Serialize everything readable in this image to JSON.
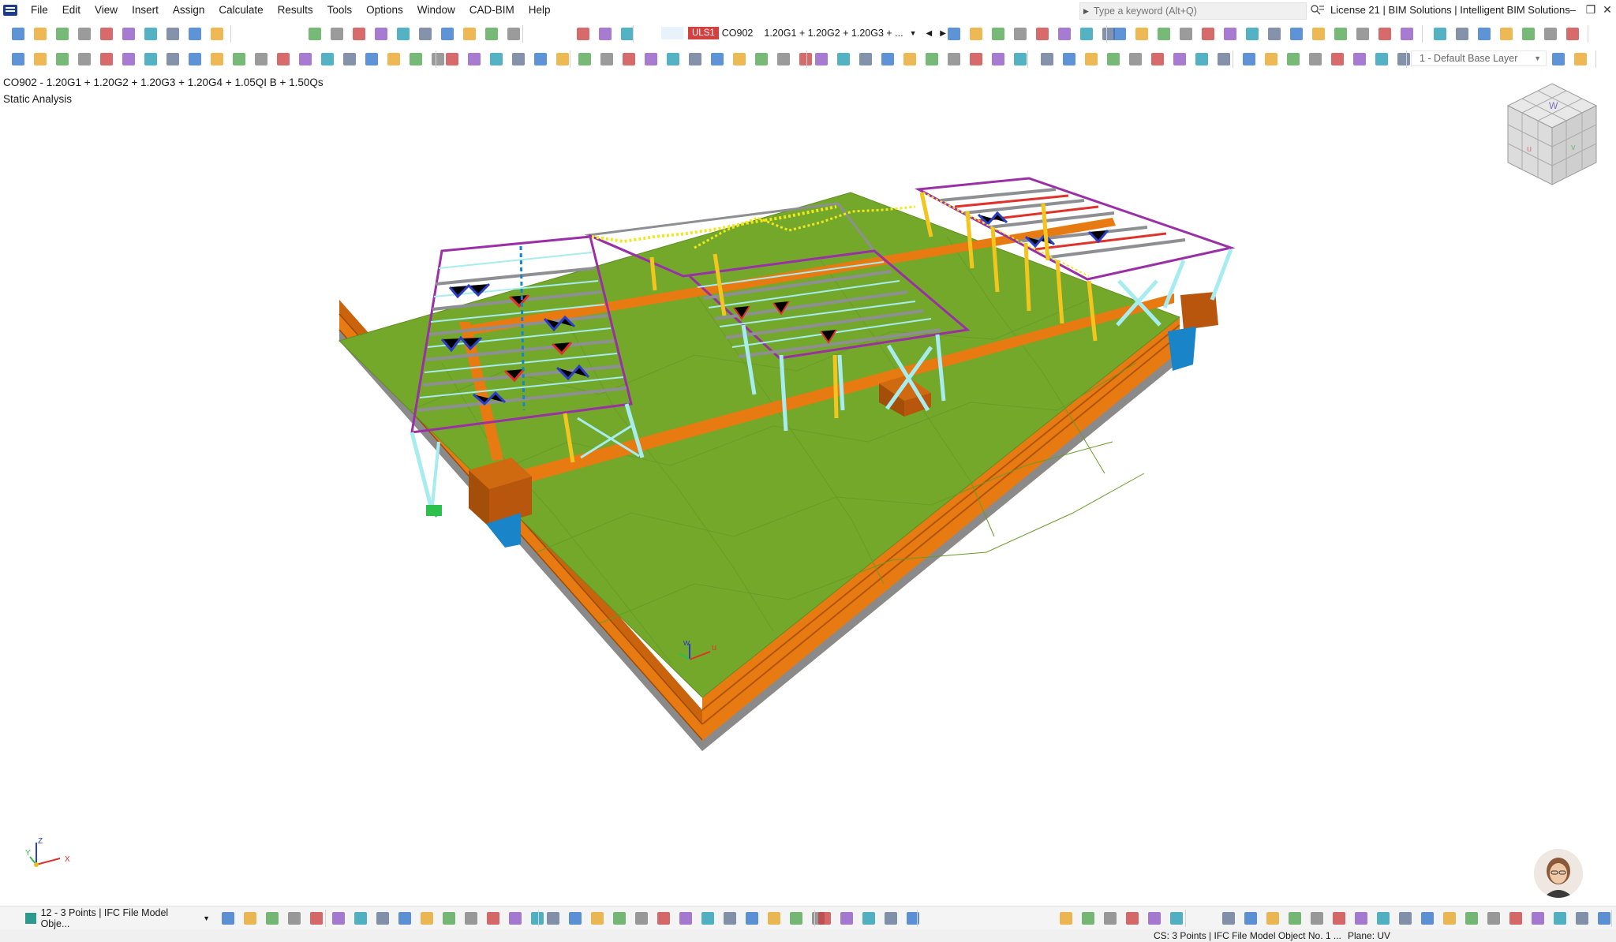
{
  "menu": {
    "items": [
      "File",
      "Edit",
      "View",
      "Insert",
      "Assign",
      "Calculate",
      "Results",
      "Tools",
      "Options",
      "Window",
      "CAD-BIM",
      "Help"
    ]
  },
  "search": {
    "placeholder": "Type a keyword (Alt+Q)"
  },
  "license": {
    "text": "License 21 | BIM Solutions | Intelligent BIM Solutions"
  },
  "window_controls": {
    "minimize": "–",
    "restore": "❐",
    "close": "✕"
  },
  "load_combo": {
    "badge": "ULS1",
    "id": "CO902",
    "formula": "1.20G1 + 1.20G2 + 1.20G3 + ...",
    "prev": "◀",
    "next": "▶"
  },
  "layer": {
    "value": "1 - Default Base Layer"
  },
  "viewport": {
    "combination_line": "CO902 - 1.20G1 + 1.20G2 + 1.20G3 + 1.20G4 + 1.05QI B + 1.50Qs",
    "analysis_type": "Static Analysis",
    "axis_labels": {
      "x": "X",
      "y": "Y",
      "z": "Z"
    },
    "local_axis_labels": {
      "u": "u",
      "w": "w"
    },
    "colors": {
      "ground": "#74a82b",
      "foundation": "#e87a12",
      "base_grey": "#8a8a8a",
      "chord": "#9a2fa6",
      "frame_grey": "#8d8f93",
      "column_yellow": "#f2c51f",
      "column_cyan": "#a7ecef",
      "brace_blue": "#2a3fc8",
      "brace_red": "#e0312b",
      "pier_brown": "#b8560d",
      "pier_blue": "#1a84c9"
    }
  },
  "navcube": {
    "faces": [
      "W",
      "u",
      "v"
    ]
  },
  "bottom": {
    "navigator_value": "12 - 3 Points | IFC File Model Obje...",
    "status_cs": "CS: 3 Points | IFC File Model Object No. 1 ...",
    "status_plane": "Plane: UV"
  },
  "toolbar_icons": [
    "new-model-icon",
    "open-icon",
    "save-icon",
    "print-icon",
    "undo-icon",
    "redo-icon",
    "table-icon",
    "view-icon",
    "select-icon",
    "load-case-icon",
    "result-icon",
    "display-icon",
    "grid-icon",
    "snap-icon",
    "layer-icon"
  ]
}
